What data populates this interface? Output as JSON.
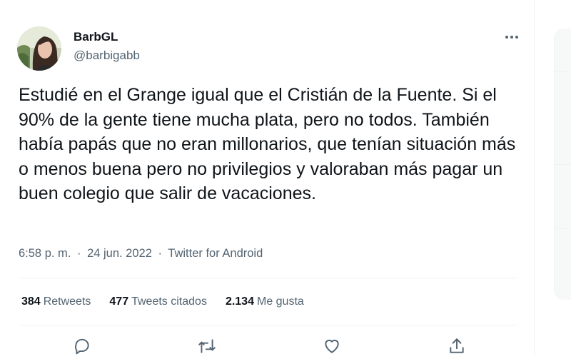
{
  "author": {
    "display_name": "BarbGL",
    "handle": "@barbigabb",
    "avatar_icon": "profile-photo"
  },
  "tweet": {
    "text": "Estudié en el Grange igual que el Cristián de la Fuente. Si el 90% de la gente tiene mucha plata, pero no todos. También había papás que no eran millonarios, que tenían situación más o menos buena pero no privilegios y valoraban más pagar un buen colegio que salir de vacaciones.",
    "time": "6:58 p. m.",
    "separator": "·",
    "date": "24 jun. 2022",
    "source": "Twitter for Android"
  },
  "stats": {
    "retweets_count": "384",
    "retweets_label": "Retweets",
    "quotes_count": "477",
    "quotes_label": "Tweets citados",
    "likes_count": "2.134",
    "likes_label": "Me gusta"
  },
  "actions": [
    "reply-icon",
    "retweet-icon",
    "like-icon",
    "share-icon"
  ],
  "colors": {
    "text_primary": "#0f1419",
    "text_secondary": "#536471",
    "divider": "#eff3f4"
  }
}
